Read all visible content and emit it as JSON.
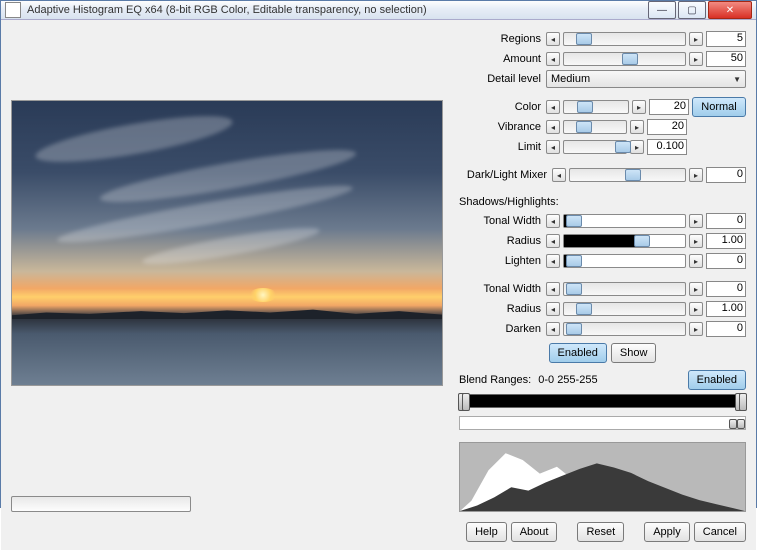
{
  "window": {
    "title": "Adaptive Histogram EQ x64 (8-bit RGB Color, Editable transparency, no selection)"
  },
  "controls": {
    "regions": {
      "label": "Regions",
      "value": "5",
      "pos": 10
    },
    "amount": {
      "label": "Amount",
      "value": "50",
      "pos": 50
    },
    "detail": {
      "label": "Detail level",
      "value": "Medium"
    },
    "color": {
      "label": "Color",
      "value": "20",
      "pos": 22
    },
    "vibrance": {
      "label": "Vibrance",
      "value": "20",
      "pos": 22
    },
    "limit": {
      "label": "Limit",
      "value": "0.100",
      "pos": 85
    },
    "darklight": {
      "label": "Dark/Light Mixer",
      "value": "0",
      "pos": 50
    },
    "sh_heading": "Shadows/Highlights:",
    "s_tonal": {
      "label": "Tonal Width",
      "value": "0",
      "pos": 3
    },
    "s_radius": {
      "label": "Radius",
      "value": "1.00",
      "pos": 60
    },
    "s_lighten": {
      "label": "Lighten",
      "value": "0",
      "pos": 3
    },
    "h_tonal": {
      "label": "Tonal Width",
      "value": "0",
      "pos": 3
    },
    "h_radius": {
      "label": "Radius",
      "value": "1.00",
      "pos": 12
    },
    "h_darken": {
      "label": "Darken",
      "value": "0",
      "pos": 3
    },
    "normal_btn": "Normal",
    "enabled_btn": "Enabled",
    "show_btn": "Show",
    "blend": {
      "label": "Blend Ranges:",
      "range": "0-0  255-255",
      "enabled": "Enabled"
    }
  },
  "footer": {
    "help": "Help",
    "about": "About",
    "reset": "Reset",
    "apply": "Apply",
    "cancel": "Cancel"
  },
  "icons": {
    "left": "◂",
    "right": "▸",
    "down": "▼",
    "min": "—",
    "max": "▢",
    "close": "✕"
  }
}
